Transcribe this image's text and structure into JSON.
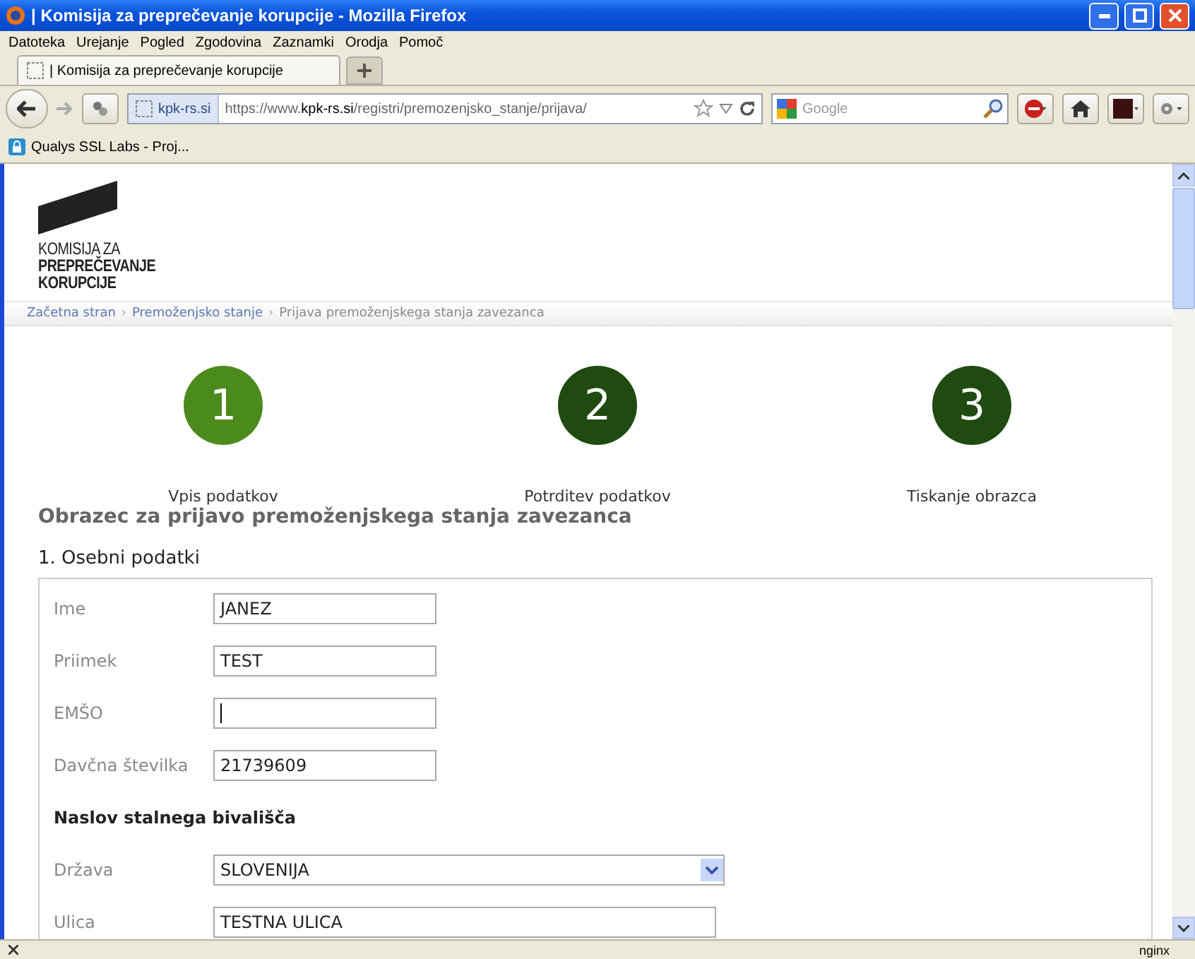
{
  "window": {
    "title": "| Komisija za preprečevanje korupcije - Mozilla Firefox"
  },
  "menu": [
    "Datoteka",
    "Urejanje",
    "Pogled",
    "Zgodovina",
    "Zaznamki",
    "Orodja",
    "Pomoč"
  ],
  "tabs": [
    {
      "label": "| Komisija za preprečevanje korupcije",
      "selected": true
    }
  ],
  "address": {
    "site": "kpk-rs.si",
    "url": "https://www.**kpk-rs.si**/registri/premozenjsko_stanje/prijava/"
  },
  "search": {
    "placeholder": "Google"
  },
  "bookmarks": [
    {
      "label": "Qualys SSL Labs - Proj..."
    }
  ],
  "logo": {
    "lines": [
      "KOMISIJA ZA",
      "PREPREČEVANJE",
      "KORUPCIJE"
    ]
  },
  "breadcrumb": {
    "separator": "›",
    "items": [
      {
        "label": "Začetna stran",
        "kind": "link"
      },
      {
        "label": "Premoženjsko stanje",
        "kind": "link"
      },
      {
        "label": "Prijava premoženjskega stanja zavezanca",
        "kind": "current"
      }
    ]
  },
  "steps": [
    {
      "number": "1",
      "label": "Vpis podatkov",
      "selected": true
    },
    {
      "number": "2",
      "label": "Potrditev podatkov",
      "selected": false
    },
    {
      "number": "3",
      "label": "Tiskanje obrazca",
      "selected": false
    }
  ],
  "form": {
    "title": "Obrazec za prijavo premoženjskega stanja zavezanca",
    "section": "1. Osebni podatki",
    "fields": [
      {
        "kind": "input",
        "label": "Ime",
        "value": "JANEZ",
        "focused": false
      },
      {
        "kind": "input",
        "label": "Priimek",
        "value": "TEST",
        "focused": false
      },
      {
        "kind": "input",
        "label": "EMŠO",
        "focused": true
      },
      {
        "kind": "input",
        "label": "Davčna številka",
        "value": "21739609",
        "focused": false
      },
      {
        "kind": "heading",
        "label": "Naslov stalnega bivališča"
      },
      {
        "kind": "select",
        "label": "Država",
        "value": "SLOVENIJA"
      },
      {
        "kind": "wide-input",
        "label": "Ulica",
        "value": "TESTNA ULICA",
        "focused": false
      }
    ]
  },
  "status_bar": {
    "text": "nginx"
  }
}
